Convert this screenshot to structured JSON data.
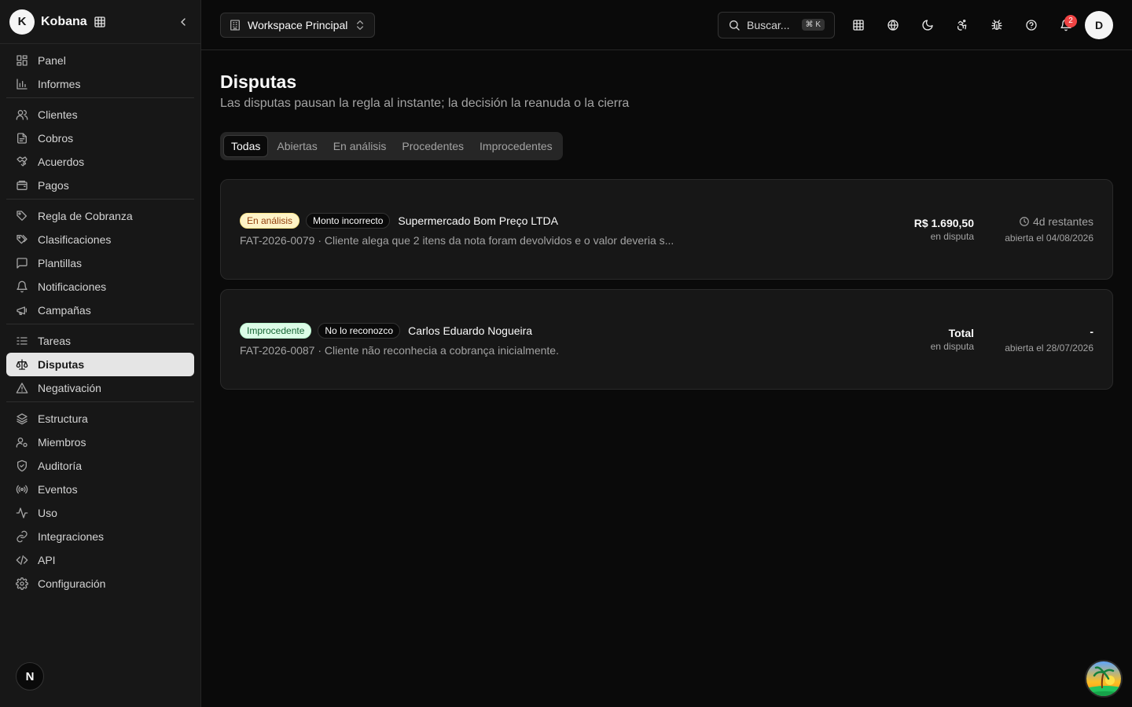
{
  "brand": {
    "initial": "K",
    "name": "Kobana"
  },
  "sidebar": {
    "groups": [
      {
        "items": [
          {
            "label": "Panel",
            "icon": "grid-icon"
          },
          {
            "label": "Informes",
            "icon": "bar-chart-icon"
          }
        ]
      },
      {
        "items": [
          {
            "label": "Clientes",
            "icon": "users-icon"
          },
          {
            "label": "Cobros",
            "icon": "file-icon"
          },
          {
            "label": "Acuerdos",
            "icon": "handshake-icon"
          },
          {
            "label": "Pagos",
            "icon": "wallet-icon"
          }
        ]
      },
      {
        "items": [
          {
            "label": "Regla de Cobranza",
            "icon": "tag-icon"
          },
          {
            "label": "Clasificaciones",
            "icon": "tags-icon"
          },
          {
            "label": "Plantillas",
            "icon": "message-icon"
          },
          {
            "label": "Notificaciones",
            "icon": "bell-icon"
          },
          {
            "label": "Campañas",
            "icon": "megaphone-icon"
          }
        ]
      },
      {
        "items": [
          {
            "label": "Tareas",
            "icon": "list-icon"
          },
          {
            "label": "Disputas",
            "icon": "scale-icon",
            "active": true
          },
          {
            "label": "Negativación",
            "icon": "warning-icon"
          }
        ]
      },
      {
        "items": [
          {
            "label": "Estructura",
            "icon": "layers-icon"
          },
          {
            "label": "Miembros",
            "icon": "users-cog-icon"
          },
          {
            "label": "Auditoría",
            "icon": "shield-icon"
          },
          {
            "label": "Eventos",
            "icon": "radio-icon"
          },
          {
            "label": "Uso",
            "icon": "activity-icon"
          },
          {
            "label": "Integraciones",
            "icon": "link-icon"
          },
          {
            "label": "API",
            "icon": "code-icon"
          },
          {
            "label": "Configuración",
            "icon": "gear-icon"
          }
        ]
      }
    ],
    "bottom_badge": "N"
  },
  "header": {
    "workspace": "Workspace Principal",
    "search_placeholder": "Buscar...",
    "search_shortcut": "⌘ K",
    "notification_count": "2",
    "user_initial": "D"
  },
  "page": {
    "title": "Disputas",
    "subtitle": "Las disputas pausan la regla al instante; la decisión la reanuda o la cierra",
    "tabs": [
      "Todas",
      "Abiertas",
      "En análisis",
      "Procedentes",
      "Improcedentes"
    ],
    "active_tab": "Todas"
  },
  "disputes": [
    {
      "status": "En análisis",
      "reason": "Monto incorrecto",
      "client": "Supermercado Bom Preço LTDA",
      "description": "FAT-2026-0079 · Cliente alega que 2 itens da nota foram devolvidos e o valor deveria s...",
      "amount": "R$ 1.690,50",
      "amount_label": "en disputa",
      "remaining": "4d restantes",
      "opened": "abierta el 04/08/2026"
    },
    {
      "status": "Improcedente",
      "reason": "No lo reconozco",
      "client": "Carlos Eduardo Nogueira",
      "description": "FAT-2026-0087 · Cliente não reconhecia a cobrança inicialmente.",
      "amount": "Total",
      "amount_label": "en disputa",
      "remaining": "-",
      "opened": "abierta el 28/07/2026"
    }
  ],
  "colors": {
    "background": "#0a0a0a",
    "sidebar": "#171717",
    "status_analysis": "#fef3c7",
    "status_improcedente": "#dcfce7",
    "notification_badge": "#ef4444"
  }
}
